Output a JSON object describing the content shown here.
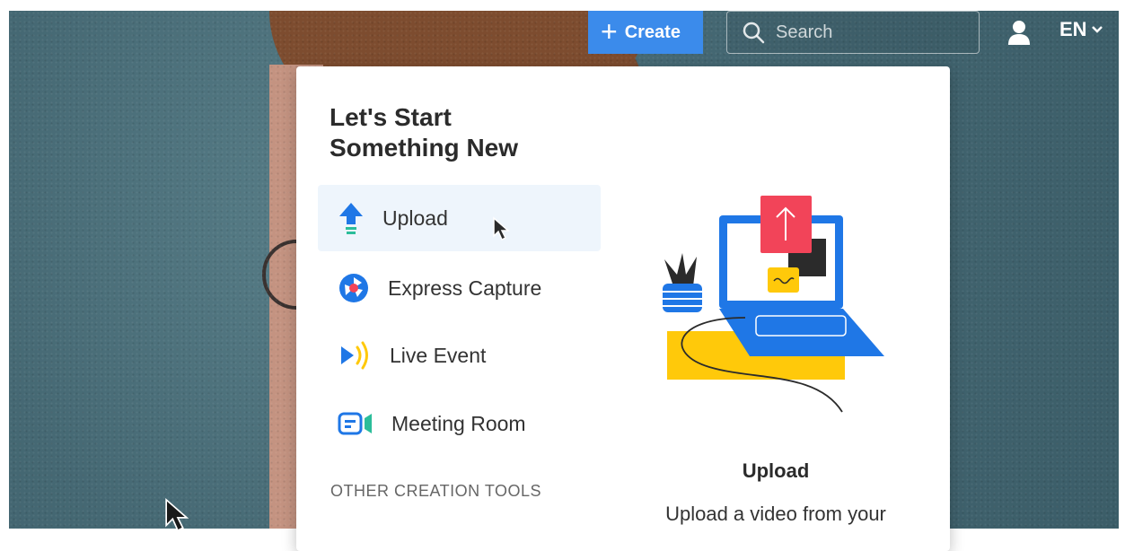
{
  "header": {
    "create_label": "Create",
    "search_placeholder": "Search",
    "language": "EN"
  },
  "panel": {
    "title": "Let's Start Something New",
    "items": [
      {
        "label": "Upload",
        "icon": "upload-arrow-icon",
        "active": true
      },
      {
        "label": "Express Capture",
        "icon": "express-capture-icon"
      },
      {
        "label": "Live Event",
        "icon": "live-event-icon"
      },
      {
        "label": "Meeting Room",
        "icon": "meeting-room-icon"
      }
    ],
    "section_label": "OTHER CREATION TOOLS",
    "detail": {
      "title": "Upload",
      "description": "Upload a video from your"
    }
  },
  "colors": {
    "accent": "#3b8beb",
    "active_bg": "#eef5fc",
    "illustration_blue": "#1f77e6",
    "illustration_red": "#f24459",
    "illustration_yellow": "#ffc90a"
  }
}
